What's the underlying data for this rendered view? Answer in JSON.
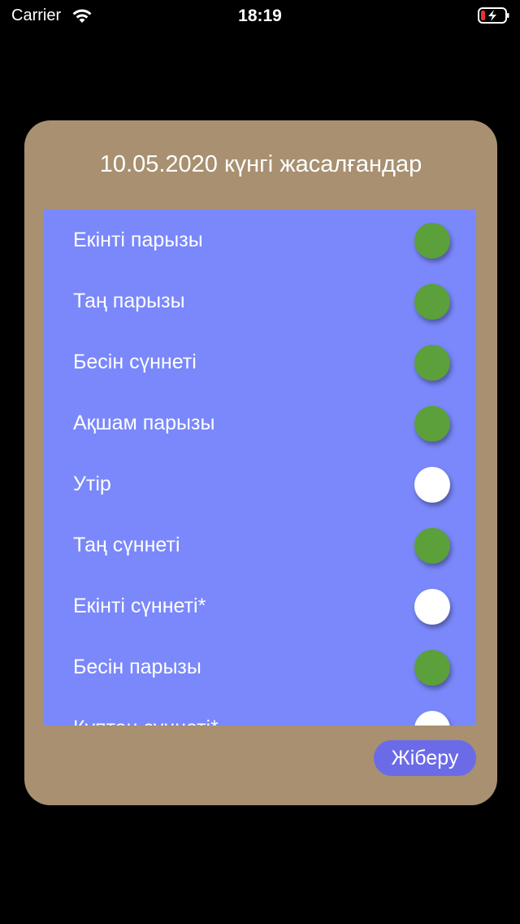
{
  "status_bar": {
    "carrier": "Carrier",
    "time": "18:19"
  },
  "modal": {
    "title": "10.05.2020 күнгі жасалғандар",
    "items": [
      {
        "label": "Екінті парызы",
        "checked": true
      },
      {
        "label": "Таң парызы",
        "checked": true
      },
      {
        "label": "Бесін сүннеті",
        "checked": true
      },
      {
        "label": "Ақшам парызы",
        "checked": true
      },
      {
        "label": "Утір",
        "checked": false
      },
      {
        "label": "Таң сүннеті",
        "checked": true
      },
      {
        "label": "Екінті сүннеті*",
        "checked": false
      },
      {
        "label": "Бесін парызы",
        "checked": true
      },
      {
        "label": "Құптан сүннеті*",
        "checked": false
      }
    ],
    "submit_label": "Жіберу"
  },
  "colors": {
    "background": "#000000",
    "card": "#a89070",
    "list_panel": "#7a88fb",
    "toggle_on": "#5ba03a",
    "toggle_off": "#ffffff",
    "submit_button": "#6b6be8",
    "battery_low": "#e8342c"
  }
}
